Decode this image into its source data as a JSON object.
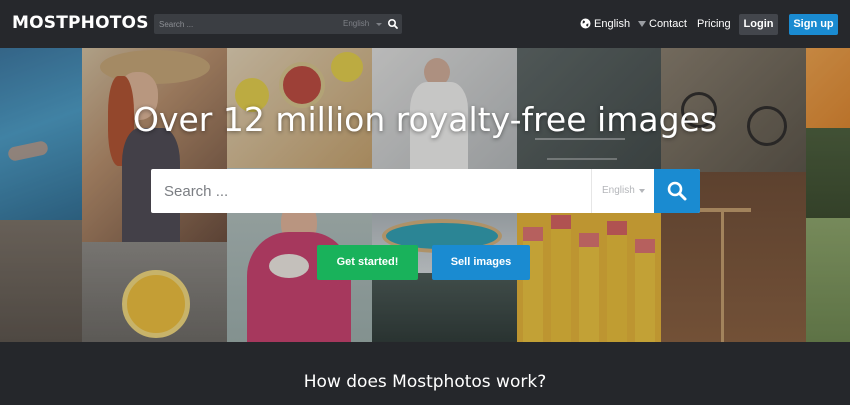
{
  "header": {
    "logo": "MOSTPHOTOS",
    "search": {
      "placeholder": "Search ...",
      "language": "English"
    },
    "language": "English",
    "links": {
      "contact": "Contact",
      "pricing": "Pricing"
    },
    "login_label": "Login",
    "signup_label": "Sign up"
  },
  "hero": {
    "title": "Over 12 million royalty-free images",
    "search": {
      "placeholder": "Search ...",
      "language": "English"
    },
    "get_started_label": "Get started!",
    "sell_images_label": "Sell images"
  },
  "section": {
    "title": "How does Mostphotos work?"
  },
  "colors": {
    "topbar": "#26282c",
    "accent_blue": "#1a8bd1",
    "accent_green": "#19b25b",
    "page_bg": "#25272b"
  }
}
